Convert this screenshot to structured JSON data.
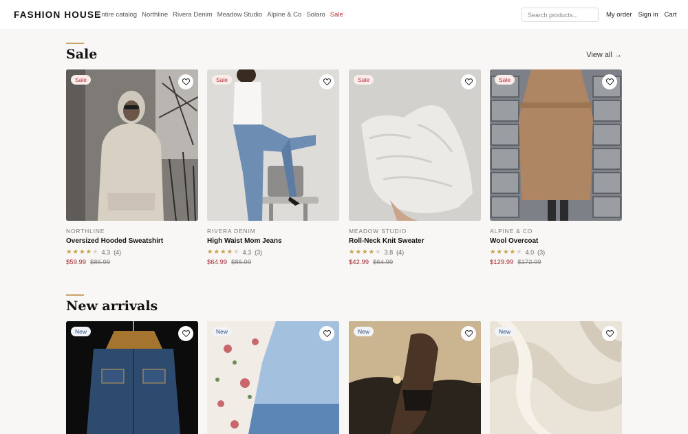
{
  "header": {
    "brand": "FASHION HOUSE",
    "nav": [
      "Entire catalog",
      "Northline",
      "Rivera Denim",
      "Meadow Studio",
      "Alpine & Co",
      "Solaro",
      "Sale"
    ],
    "search_placeholder": "Search products...",
    "actions": [
      "My order",
      "Sign in",
      "Cart"
    ]
  },
  "colors": {
    "accent": "#c9a26c",
    "sale": "#b8323a",
    "price": "#a5282f",
    "star": "#c9a24a"
  },
  "sale_section": {
    "title": "Sale",
    "view_all": "View all →",
    "products": [
      {
        "badge": "Sale",
        "brand": "NORTHLINE",
        "name": "Oversized Hooded Sweatshirt",
        "rating": 4.3,
        "rating_text": "4.3",
        "reviews": "(4)",
        "price": "$59.99",
        "old_price": "$86.99",
        "image": "hoodie"
      },
      {
        "badge": "Sale",
        "brand": "RIVERA DENIM",
        "name": "High Waist Mom Jeans",
        "rating": 4.3,
        "rating_text": "4.3",
        "reviews": "(3)",
        "price": "$64.99",
        "old_price": "$86.99",
        "image": "jeans"
      },
      {
        "badge": "Sale",
        "brand": "MEADOW STUDIO",
        "name": "Roll-Neck Knit Sweater",
        "rating": 3.8,
        "rating_text": "3.8",
        "reviews": "(4)",
        "price": "$42.99",
        "old_price": "$64.99",
        "image": "sweater"
      },
      {
        "badge": "Sale",
        "brand": "ALPINE & CO",
        "name": "Wool Overcoat",
        "rating": 4.0,
        "rating_text": "4.0",
        "reviews": "(3)",
        "price": "$129.99",
        "old_price": "$172.99",
        "image": "coat"
      }
    ]
  },
  "new_section": {
    "title": "New arrivals",
    "products": [
      {
        "badge": "New",
        "image": "denim-jacket"
      },
      {
        "badge": "New",
        "image": "floral-dress"
      },
      {
        "badge": "New",
        "image": "swimsuit"
      },
      {
        "badge": "New",
        "image": "satin"
      }
    ]
  }
}
